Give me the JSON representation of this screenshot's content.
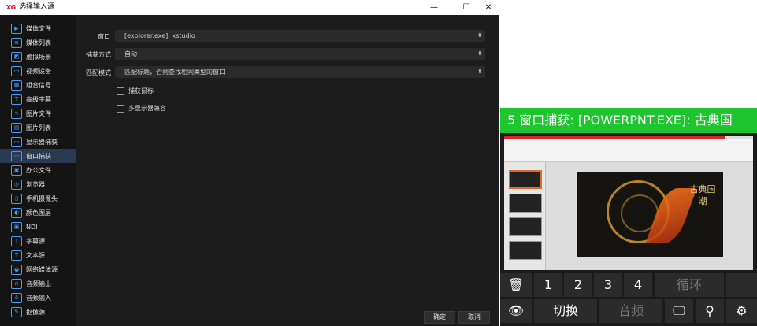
{
  "dialog": {
    "app_logo": "XG",
    "title": "选择输入源",
    "minimize": "—",
    "maximize": "☐",
    "close": "✕"
  },
  "sidebar": {
    "items": [
      {
        "label": "媒体文件",
        "icon": "▶"
      },
      {
        "label": "媒体列表",
        "icon": "≡"
      },
      {
        "label": "虚拟场景",
        "icon": "◩"
      },
      {
        "label": "视频设备",
        "icon": "▭"
      },
      {
        "label": "组合信号",
        "icon": "▦"
      },
      {
        "label": "高级字幕",
        "icon": "T"
      },
      {
        "label": "图片文件",
        "icon": "∿"
      },
      {
        "label": "图片列表",
        "icon": "▤"
      },
      {
        "label": "显示器捕获",
        "icon": "▭"
      },
      {
        "label": "窗口捕获",
        "icon": "▭"
      },
      {
        "label": "办公文件",
        "icon": "▣"
      },
      {
        "label": "浏览器",
        "icon": "◎"
      },
      {
        "label": "手机摄像头",
        "icon": "▯"
      },
      {
        "label": "颜色图层",
        "icon": "◐"
      },
      {
        "label": "NDI",
        "icon": "▣"
      },
      {
        "label": "字幕源",
        "icon": "T"
      },
      {
        "label": "文本源",
        "icon": "T"
      },
      {
        "label": "网络媒体源",
        "icon": "◒"
      },
      {
        "label": "音频输出",
        "icon": "∩"
      },
      {
        "label": "音频输入",
        "icon": "♁"
      },
      {
        "label": "抠像源",
        "icon": "✎"
      }
    ],
    "active_index": 9
  },
  "form": {
    "window_label": "窗口",
    "window_value": "[explorer.exe]: xstudio",
    "capture_label": "捕获方式",
    "capture_value": "自动",
    "match_label": "匹配模式",
    "match_value": "匹配标题，否则查找相同类型的窗口",
    "capture_mouse_label": "捕获鼠标",
    "capture_mouse_checked": false,
    "multi_monitor_label": "多显示器兼容",
    "multi_monitor_checked": false
  },
  "buttons": {
    "ok": "确定",
    "cancel": "取消"
  },
  "preview": {
    "title": "5 窗口捕获: [POWERPNT.EXE]: 古典国",
    "slide_title": "古典国潮",
    "controls_row1": [
      "1",
      "2",
      "3",
      "4",
      "循环"
    ],
    "controls_row2": [
      "切换",
      "音频"
    ]
  },
  "colors": {
    "accent_blue": "#4a9bf5",
    "preview_green": "#1fc52f",
    "dialog_bg": "#1c1c1c"
  }
}
